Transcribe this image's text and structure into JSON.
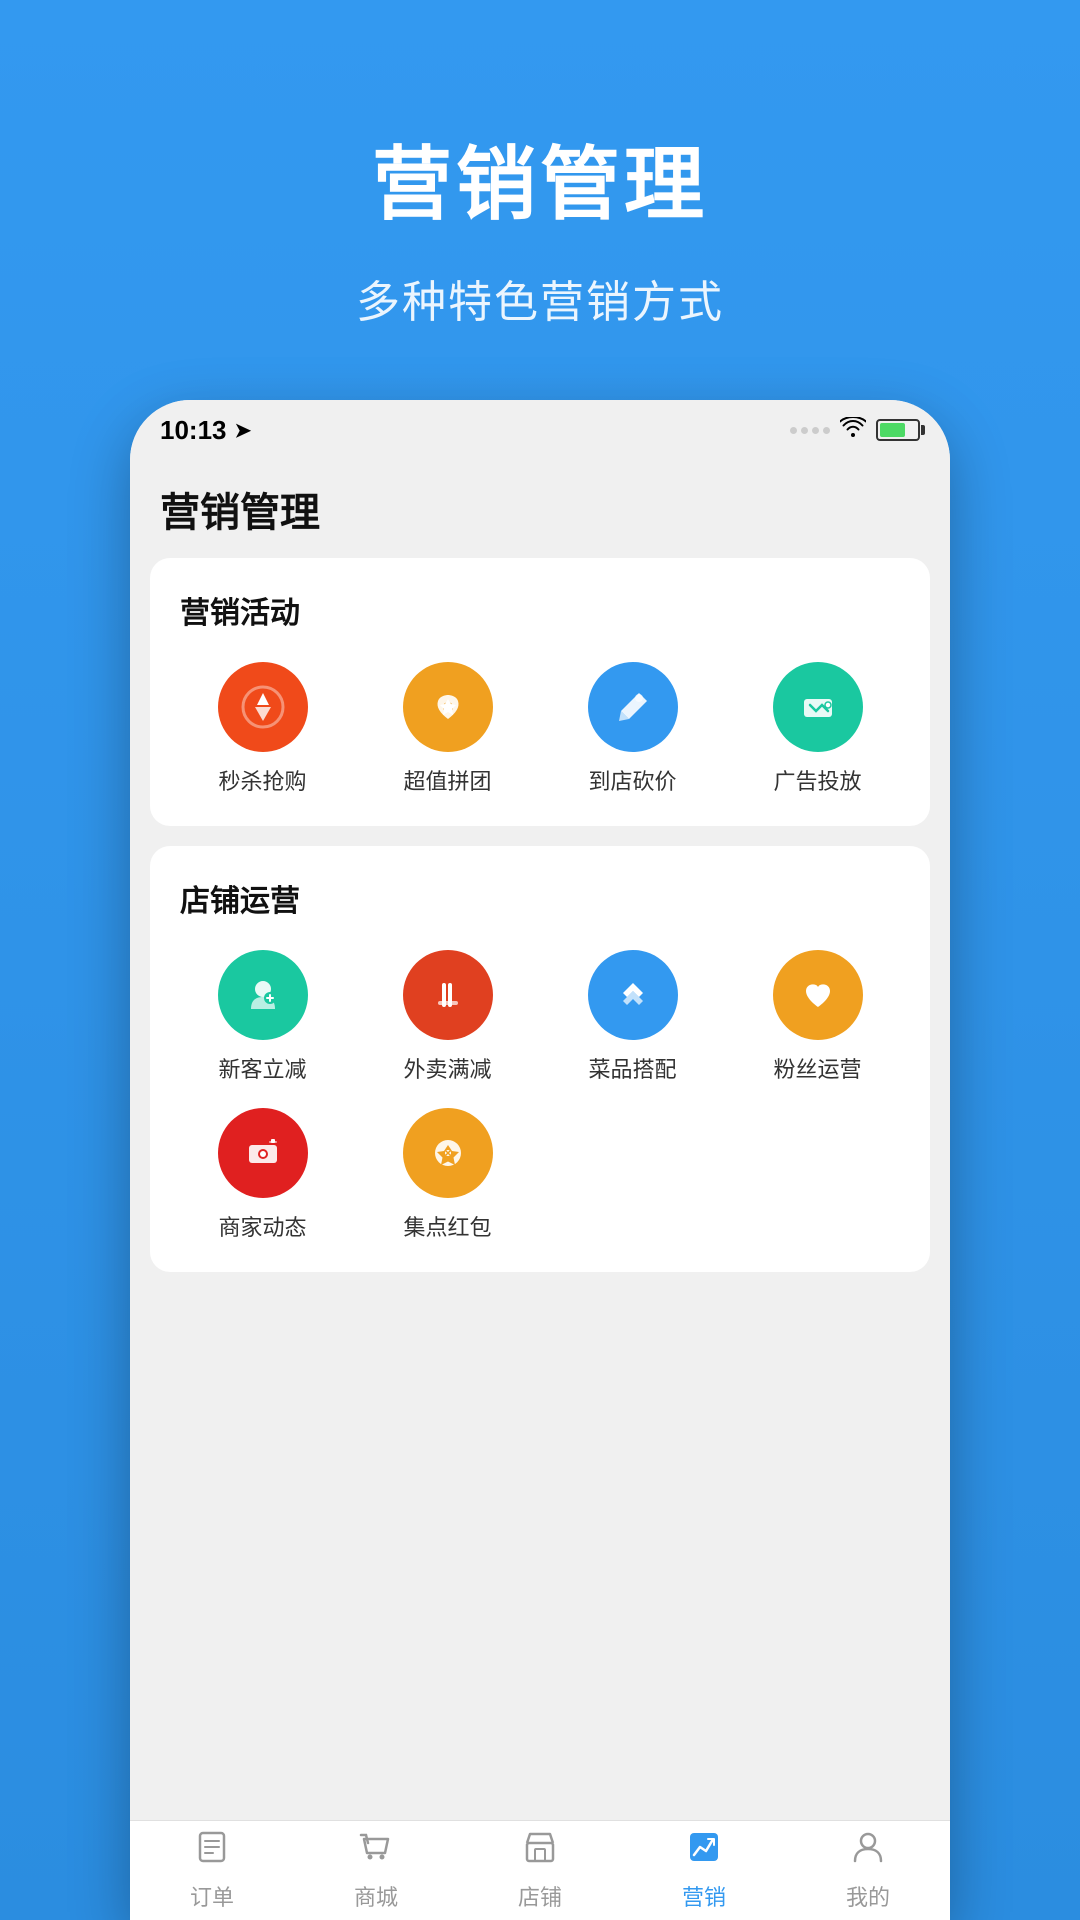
{
  "hero": {
    "title": "营销管理",
    "subtitle": "多种特色营销方式"
  },
  "statusBar": {
    "time": "10:13",
    "timeArrow": "▶"
  },
  "pageTitle": "营销管理",
  "sections": [
    {
      "id": "marketing-activities",
      "title": "营销活动",
      "items": [
        {
          "id": "seckill",
          "label": "秒杀抢购",
          "color": "#f04a1a",
          "icon": "seckill"
        },
        {
          "id": "group",
          "label": "超值拼团",
          "color": "#f0a020",
          "icon": "group"
        },
        {
          "id": "choprice",
          "label": "到店砍价",
          "color": "#3399f0",
          "icon": "choprice"
        },
        {
          "id": "ads",
          "label": "广告投放",
          "color": "#1ac8a0",
          "icon": "ads"
        }
      ]
    },
    {
      "id": "shop-operations",
      "title": "店铺运营",
      "items": [
        {
          "id": "newcustomer",
          "label": "新客立减",
          "color": "#1ac8a0",
          "icon": "newcustomer"
        },
        {
          "id": "delivery",
          "label": "外卖满减",
          "color": "#e04020",
          "icon": "delivery"
        },
        {
          "id": "dish",
          "label": "菜品搭配",
          "color": "#3399f0",
          "icon": "dish"
        },
        {
          "id": "fans",
          "label": "粉丝运营",
          "color": "#f0a020",
          "icon": "fans"
        },
        {
          "id": "merchant",
          "label": "商家动态",
          "color": "#e02020",
          "icon": "merchant"
        },
        {
          "id": "redpacket",
          "label": "集点红包",
          "color": "#f0a020",
          "icon": "redpacket"
        }
      ]
    }
  ],
  "bottomNav": [
    {
      "id": "orders",
      "label": "订单",
      "active": false
    },
    {
      "id": "mall",
      "label": "商城",
      "active": false
    },
    {
      "id": "store",
      "label": "店铺",
      "active": false
    },
    {
      "id": "marketing",
      "label": "营销",
      "active": true
    },
    {
      "id": "mine",
      "label": "我的",
      "active": false
    }
  ]
}
